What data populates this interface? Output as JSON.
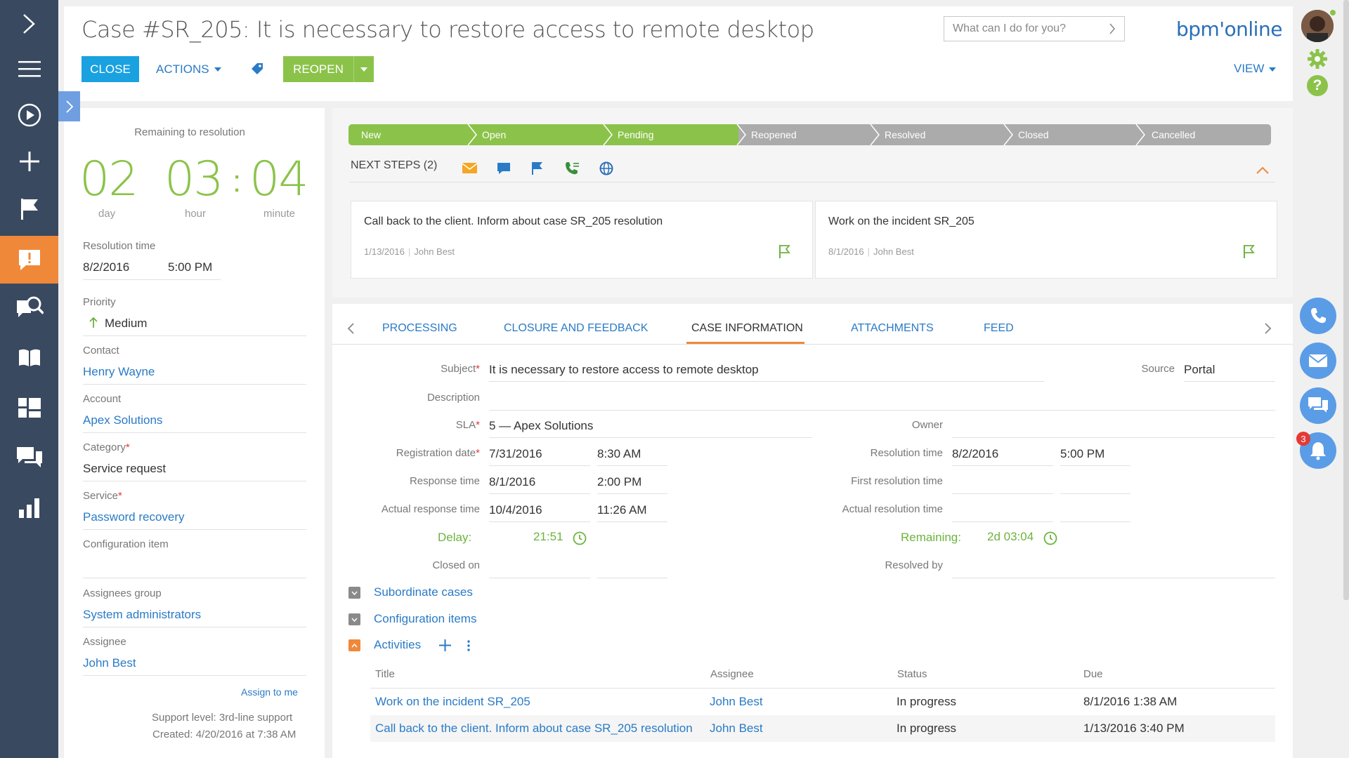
{
  "header": {
    "title": "Case #SR_205: It is necessary to restore access to remote desktop",
    "close_label": "CLOSE",
    "actions_label": "ACTIONS",
    "reopen_label": "REOPEN",
    "view_label": "VIEW",
    "search_placeholder": "What can I do for you?",
    "logo_text": "bpm'online"
  },
  "notifications_count": "3",
  "left_panel": {
    "remaining_label": "Remaining to resolution",
    "timer": {
      "day": "02",
      "hour": "03",
      "minute": "04",
      "sep": ":",
      "day_label": "day",
      "hour_label": "hour",
      "minute_label": "minute"
    },
    "resolution_time_label": "Resolution time",
    "resolution_date": "8/2/2016",
    "resolution_hour": "5:00 PM",
    "priority_label": "Priority",
    "priority_value": "Medium",
    "contact_label": "Contact",
    "contact_value": "Henry Wayne",
    "account_label": "Account",
    "account_value": "Apex Solutions",
    "category_label": "Category",
    "category_value": "Service request",
    "service_label": "Service",
    "service_value": "Password recovery",
    "config_item_label": "Configuration item",
    "assignees_group_label": "Assignees group",
    "assignees_group_value": "System administrators",
    "assignee_label": "Assignee",
    "assignee_value": "John Best",
    "assign_to_me": "Assign to me",
    "support_level": "Support level: 3rd-line support",
    "created": "Created: 4/20/2016 at 7:38 AM"
  },
  "stages": [
    {
      "label": "New",
      "state": "done"
    },
    {
      "label": "Open",
      "state": "done"
    },
    {
      "label": "Pending",
      "state": "done"
    },
    {
      "label": "Reopened",
      "state": "todo"
    },
    {
      "label": "Resolved",
      "state": "todo"
    },
    {
      "label": "Closed",
      "state": "todo"
    },
    {
      "label": "Cancelled",
      "state": "todo"
    }
  ],
  "next_steps": {
    "label": "NEXT STEPS (2)",
    "tasks": [
      {
        "title": "Call back to the client. Inform about case SR_205 resolution",
        "date": "1/13/2016",
        "owner": "John Best"
      },
      {
        "title": "Work on the incident SR_205",
        "date": "8/1/2016",
        "owner": "John Best"
      }
    ]
  },
  "tabs": [
    "PROCESSING",
    "CLOSURE AND FEEDBACK",
    "CASE INFORMATION",
    "ATTACHMENTS",
    "FEED"
  ],
  "case_info": {
    "subject_label": "Subject",
    "subject_value": "It is necessary to restore access to remote desktop",
    "source_label": "Source",
    "source_value": "Portal",
    "description_label": "Description",
    "sla_label": "SLA",
    "sla_value": "5 — Apex Solutions",
    "owner_label": "Owner",
    "registration_label": "Registration date",
    "registration_date": "7/31/2016",
    "registration_time": "8:30 AM",
    "resolution_time_label": "Resolution time",
    "resolution_date": "8/2/2016",
    "resolution_time": "5:00 PM",
    "response_label": "Response time",
    "response_date": "8/1/2016",
    "response_time": "2:00 PM",
    "first_resolution_label": "First resolution time",
    "actual_response_label": "Actual response time",
    "actual_response_date": "10/4/2016",
    "actual_response_time": "11:26 AM",
    "actual_resolution_label": "Actual resolution time",
    "delay_label": "Delay:",
    "delay_value": "21:51",
    "remaining_label": "Remaining:",
    "remaining_value": "2d 03:04",
    "closed_on_label": "Closed on",
    "resolved_by_label": "Resolved by"
  },
  "sections": {
    "subordinate": "Subordinate cases",
    "config_items": "Configuration items",
    "activities": "Activities"
  },
  "activities": {
    "headers": [
      "Title",
      "Assignee",
      "Status",
      "Due"
    ],
    "rows": [
      {
        "title": "Work on the incident SR_205",
        "assignee": "John Best",
        "status": "In progress",
        "due": "8/1/2016 1:38 AM"
      },
      {
        "title": "Call back to the client. Inform about case SR_205 resolution",
        "assignee": "John Best",
        "status": "In progress",
        "due": "1/13/2016 3:40 PM"
      }
    ]
  },
  "colors": {
    "accent": "#f0883a",
    "primary": "#1aa1e0",
    "success": "#8bc34a",
    "nav": "#394960"
  }
}
